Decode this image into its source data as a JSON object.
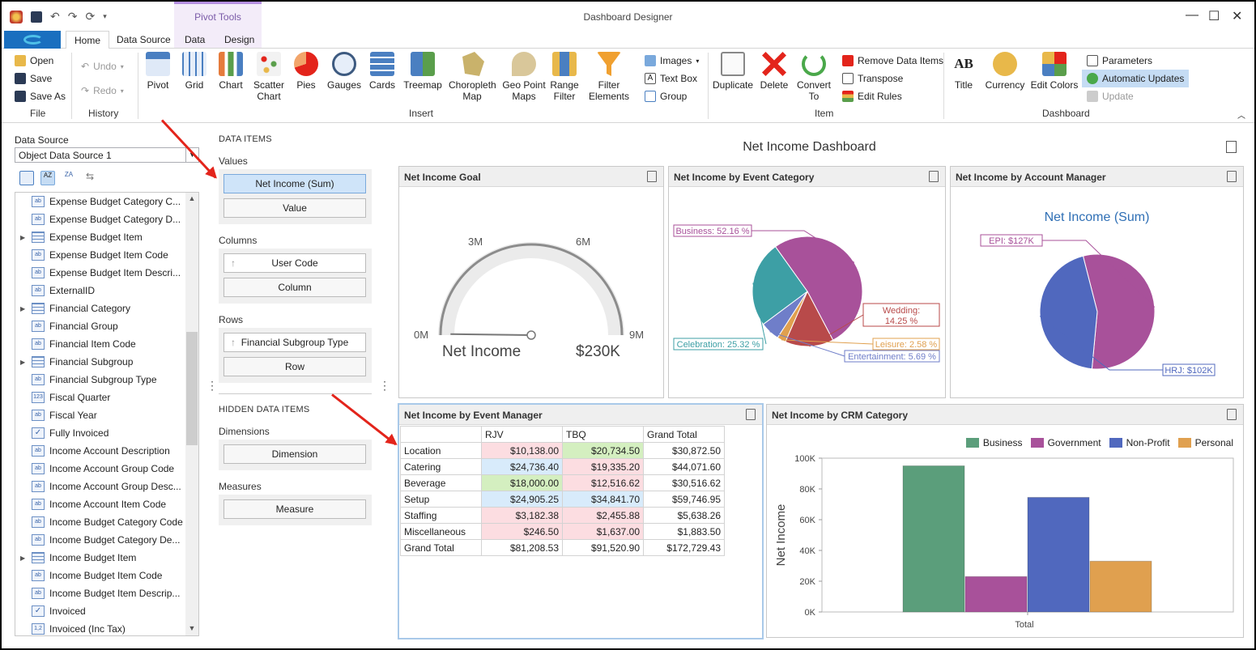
{
  "window": {
    "title": "Dashboard Designer",
    "context_tab": "Pivot Tools"
  },
  "tabs": [
    "Home",
    "Data Source",
    "Data",
    "Design"
  ],
  "ribbon": {
    "file": {
      "open": "Open",
      "save": "Save",
      "save_as": "Save As",
      "group": "File"
    },
    "history": {
      "undo": "Undo",
      "redo": "Redo",
      "group": "History"
    },
    "insert": {
      "items": [
        "Pivot",
        "Grid",
        "Chart",
        "Scatter Chart",
        "Pies",
        "Gauges",
        "Cards",
        "Treemap",
        "Choropleth Map",
        "Geo Point Maps",
        "Range Filter",
        "Filter Elements"
      ],
      "images": "Images",
      "text_box": "Text Box",
      "group_btn": "Group",
      "group": "Insert"
    },
    "item": {
      "duplicate": "Duplicate",
      "delete": "Delete",
      "convert_to": "Convert To",
      "remove_data_items": "Remove Data Items",
      "transpose": "Transpose",
      "edit_rules": "Edit Rules",
      "group": "Item"
    },
    "dashboard": {
      "title": "Title",
      "currency": "Currency",
      "edit_colors": "Edit Colors",
      "parameters": "Parameters",
      "automatic_updates": "Automatic Updates",
      "update": "Update",
      "group": "Dashboard"
    }
  },
  "left": {
    "data_source_label": "Data Source",
    "data_source_value": "Object Data Source 1",
    "fields": [
      {
        "name": "Expense Budget Category C...",
        "type": "ab",
        "exp": false
      },
      {
        "name": "Expense Budget Category D...",
        "type": "ab",
        "exp": false
      },
      {
        "name": "Expense Budget Item",
        "type": "tbl",
        "exp": true
      },
      {
        "name": "Expense Budget Item Code",
        "type": "ab",
        "exp": false
      },
      {
        "name": "Expense Budget Item Descri...",
        "type": "ab",
        "exp": false
      },
      {
        "name": "ExternalID",
        "type": "ab",
        "exp": false
      },
      {
        "name": "Financial Category",
        "type": "tbl",
        "exp": true
      },
      {
        "name": "Financial Group",
        "type": "ab",
        "exp": false
      },
      {
        "name": "Financial Item Code",
        "type": "ab",
        "exp": false
      },
      {
        "name": "Financial Subgroup",
        "type": "tbl",
        "exp": true
      },
      {
        "name": "Financial Subgroup Type",
        "type": "ab",
        "exp": false
      },
      {
        "name": "Fiscal Quarter",
        "type": "123",
        "exp": false
      },
      {
        "name": "Fiscal Year",
        "type": "ab",
        "exp": false
      },
      {
        "name": "Fully Invoiced",
        "type": "chk",
        "exp": false
      },
      {
        "name": "Income Account Description",
        "type": "ab",
        "exp": false
      },
      {
        "name": "Income Account Group Code",
        "type": "ab",
        "exp": false
      },
      {
        "name": "Income Account Group Desc...",
        "type": "ab",
        "exp": false
      },
      {
        "name": "Income Account Item Code",
        "type": "ab",
        "exp": false
      },
      {
        "name": "Income Budget Category Code",
        "type": "ab",
        "exp": false
      },
      {
        "name": "Income Budget Category De...",
        "type": "ab",
        "exp": false
      },
      {
        "name": "Income Budget Item",
        "type": "tbl",
        "exp": true
      },
      {
        "name": "Income Budget Item Code",
        "type": "ab",
        "exp": false
      },
      {
        "name": "Income Budget Item Descrip...",
        "type": "ab",
        "exp": false
      },
      {
        "name": "Invoiced",
        "type": "chk",
        "exp": false
      },
      {
        "name": "Invoiced (Inc Tax)",
        "type": "1,2",
        "exp": false
      }
    ]
  },
  "data_items": {
    "title": "DATA ITEMS",
    "values_label": "Values",
    "value_sel": "Net Income (Sum)",
    "value_empty": "Value",
    "columns_label": "Columns",
    "column_item": "User Code",
    "column_empty": "Column",
    "rows_label": "Rows",
    "row_item": "Financial Subgroup Type",
    "row_empty": "Row",
    "hidden_title": "HIDDEN DATA ITEMS",
    "dimensions_label": "Dimensions",
    "dimension_empty": "Dimension",
    "measures_label": "Measures",
    "measure_empty": "Measure"
  },
  "dashboard": {
    "title": "Net Income Dashboard",
    "gauge": {
      "title": "Net Income Goal",
      "label": "Net Income",
      "value_text": "$230K",
      "ticks": [
        "0M",
        "3M",
        "6M",
        "9M"
      ],
      "value": 230000,
      "max": 9000000
    },
    "pie1": {
      "title": "Net Income by Event Category",
      "slices": [
        {
          "label": "Business: 52.16 %",
          "value": 52.16,
          "color": "#a8519a"
        },
        {
          "label": "Wedding: 14.25 %",
          "value": 14.25,
          "color": "#b84a4a"
        },
        {
          "label": "Leisure: 2.58 %",
          "value": 2.58,
          "color": "#e0a04f"
        },
        {
          "label": "Entertainment: 5.69 %",
          "value": 5.69,
          "color": "#6f7ec9"
        },
        {
          "label": "Celebration: 25.32 %",
          "value": 25.32,
          "color": "#3d9fa5"
        }
      ]
    },
    "pie2": {
      "title": "Net Income by Account Manager",
      "subtitle": "Net Income (Sum)",
      "slices": [
        {
          "label": "EPI: $127K",
          "value": 127,
          "color": "#a8519a"
        },
        {
          "label": "HRJ: $102K",
          "value": 102,
          "color": "#5068be"
        }
      ]
    },
    "pivot": {
      "title": "Net Income by Event Manager",
      "columns": [
        "RJV",
        "TBQ",
        "Grand Total"
      ],
      "rows": [
        {
          "label": "Location",
          "v": [
            "$10,138.00",
            "$20,734.50",
            "$30,872.50"
          ],
          "c": [
            "#fcdde1",
            "#d4efc0",
            ""
          ]
        },
        {
          "label": "Catering",
          "v": [
            "$24,736.40",
            "$19,335.20",
            "$44,071.60"
          ],
          "c": [
            "#d8ebfb",
            "#fcdde1",
            ""
          ]
        },
        {
          "label": "Beverage",
          "v": [
            "$18,000.00",
            "$12,516.62",
            "$30,516.62"
          ],
          "c": [
            "#d4efc0",
            "#fcdde1",
            ""
          ]
        },
        {
          "label": "Setup",
          "v": [
            "$24,905.25",
            "$34,841.70",
            "$59,746.95"
          ],
          "c": [
            "#d8ebfb",
            "#d8ebfb",
            ""
          ]
        },
        {
          "label": "Staffing",
          "v": [
            "$3,182.38",
            "$2,455.88",
            "$5,638.26"
          ],
          "c": [
            "#fcdde1",
            "#fcdde1",
            ""
          ]
        },
        {
          "label": "Miscellaneous",
          "v": [
            "$246.50",
            "$1,637.00",
            "$1,883.50"
          ],
          "c": [
            "#fcdde1",
            "#fcdde1",
            ""
          ]
        },
        {
          "label": "Grand Total",
          "v": [
            "$81,208.53",
            "$91,520.90",
            "$172,729.43"
          ],
          "c": [
            "",
            "",
            ""
          ]
        }
      ]
    }
  },
  "chart_data": {
    "type": "bar",
    "title": "Net Income by CRM Category",
    "categories": [
      "Total"
    ],
    "series": [
      {
        "name": "Business",
        "values": [
          95000
        ],
        "color": "#5b9e7b"
      },
      {
        "name": "Government",
        "values": [
          23000
        ],
        "color": "#a8519a"
      },
      {
        "name": "Non-Profit",
        "values": [
          74500
        ],
        "color": "#5068be"
      },
      {
        "name": "Personal",
        "values": [
          33000
        ],
        "color": "#e0a04f"
      }
    ],
    "xlabel": "",
    "ylabel": "Net Income",
    "yticks": [
      "0K",
      "20K",
      "40K",
      "60K",
      "80K",
      "100K"
    ],
    "ylim": [
      0,
      100000
    ],
    "legend": "top-right",
    "grid": false
  }
}
